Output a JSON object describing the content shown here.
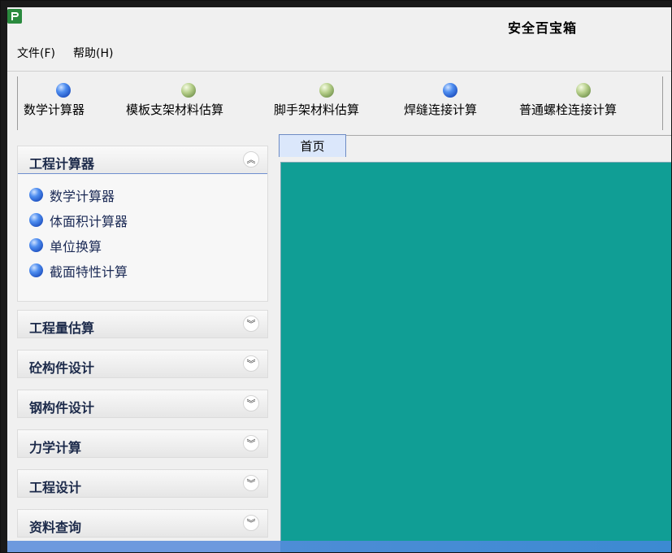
{
  "window": {
    "title": "安全百宝箱"
  },
  "menu": {
    "file": "文件(F)",
    "help": "帮助(H)"
  },
  "toolbar": {
    "buttons": [
      {
        "label": "数学计算器",
        "icon": "blue-ball-icon"
      },
      {
        "label": "模板支架材料估算",
        "icon": "green-ball-icon"
      },
      {
        "label": "脚手架材料估算",
        "icon": "green-ball-icon"
      },
      {
        "label": "焊缝连接计算",
        "icon": "blue-ball-icon"
      },
      {
        "label": "普通螺栓连接计算",
        "icon": "green-ball-icon"
      }
    ]
  },
  "sidebar": {
    "open_group": {
      "title": "工程计算器",
      "items": [
        "数学计算器",
        "体面积计算器",
        "单位换算",
        "截面特性计算"
      ]
    },
    "closed_groups": [
      "工程量估算",
      "砼构件设计",
      "钢构件设计",
      "力学计算",
      "工程设计",
      "资料查询"
    ]
  },
  "tabs": {
    "home": "首页"
  },
  "colors": {
    "content_bg": "#109e95",
    "tab_bg": "#dbe7fb",
    "accent_blue": "#4f8ef0",
    "accent_green": "#b6cf8a"
  }
}
